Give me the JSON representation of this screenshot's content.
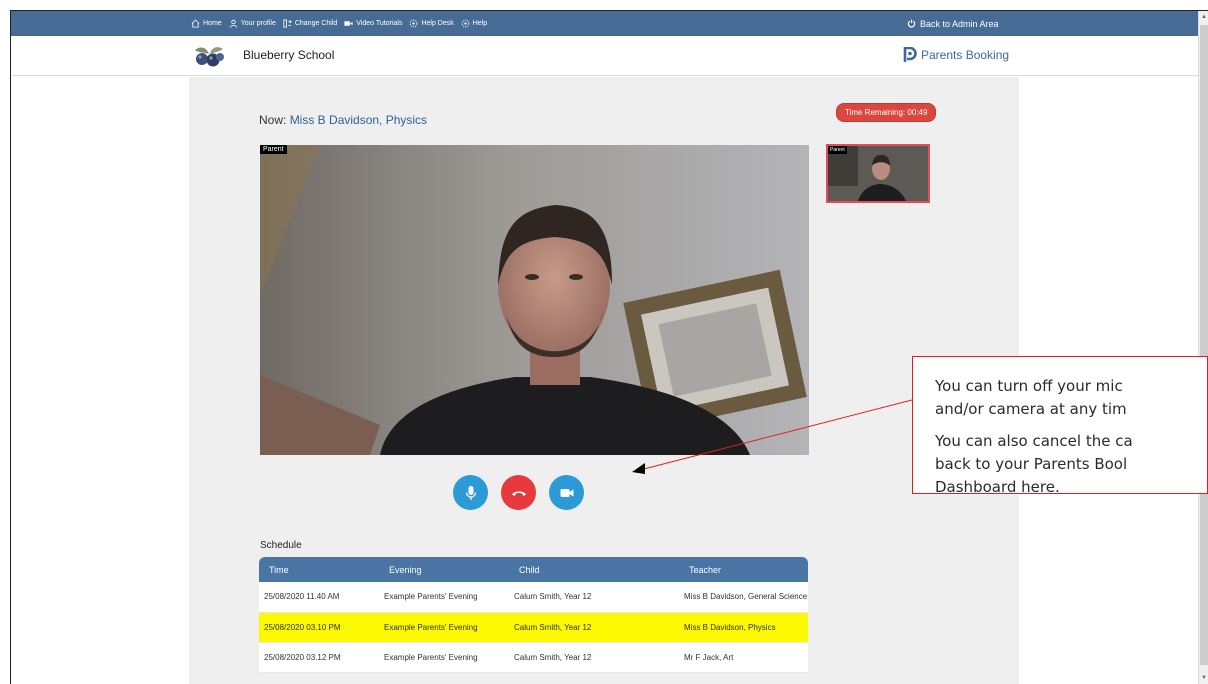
{
  "topbar": {
    "items": [
      {
        "label": "Home",
        "icon": "home-icon"
      },
      {
        "label": "Your profile",
        "icon": "user-icon"
      },
      {
        "label": "Change Child",
        "icon": "swap-icon"
      },
      {
        "label": "Video Tutorials",
        "icon": "video-icon"
      },
      {
        "label": "Help Desk",
        "icon": "help-desk-icon"
      },
      {
        "label": "Help",
        "icon": "help-icon"
      }
    ],
    "admin_link": "Back to Admin Area"
  },
  "header": {
    "school_name": "Blueberry School",
    "brand": "Parents Booking"
  },
  "call": {
    "now_prefix": "Now: ",
    "teacher": "Miss B Davidson, Physics",
    "time_remaining": "Time Remaining: 00:49",
    "main_tag": "Parent",
    "thumb_tag": "Parent"
  },
  "schedule": {
    "title": "Schedule",
    "columns": [
      "Time",
      "Evening",
      "Child",
      "Teacher"
    ],
    "rows": [
      {
        "time": "25/08/2020 11.40 AM",
        "evening": "Example Parents' Evening",
        "child": "Calum Smith, Year 12",
        "teacher": "Miss B Davidson, General Science",
        "highlight": false
      },
      {
        "time": "25/08/2020 03.10 PM",
        "evening": "Example Parents' Evening",
        "child": "Calum Smith, Year 12",
        "teacher": "Miss B Davidson, Physics",
        "highlight": true
      },
      {
        "time": "25/08/2020 03.12 PM",
        "evening": "Example Parents' Evening",
        "child": "Calum Smith, Year 12",
        "teacher": "Mr F Jack, Art",
        "highlight": false
      }
    ]
  },
  "callout": {
    "line1": "You can turn off your mic",
    "line2": "and/or camera at any tim",
    "line3": "You can also cancel the ca",
    "line4": "back to your Parents Bool",
    "line5": "Dashboard here."
  },
  "colors": {
    "nav_bar": "#466b95",
    "accent_blue": "#2d9ad8",
    "hangup_red": "#e8393e",
    "highlight_yellow": "#fbf800",
    "callout_border": "#e02020"
  }
}
